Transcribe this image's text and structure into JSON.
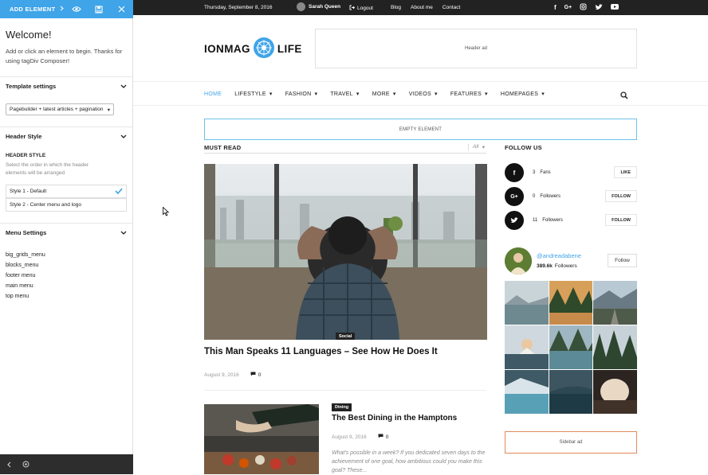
{
  "panel": {
    "add_element": "ADD ELEMENT",
    "welcome_title": "Welcome!",
    "welcome_text": "Add or click an element to begin. Thanks for using tagDiv Composer!",
    "template_settings": "Template settings",
    "template_value": "Pagebuilder + latest articles + pagination",
    "header_style": "Header Style",
    "header_style_label": "HEADER STYLE",
    "header_style_desc": "Select the order in which the header elements will be arranged",
    "style1": "Style 1 - Default",
    "style2": "Style 2 - Center menu and logo",
    "menu_settings": "Menu Settings",
    "menus": [
      "big_grids_menu",
      "blocks_menu",
      "footer menu",
      "main menu",
      "top menu"
    ]
  },
  "topbar": {
    "date": "Thursday, September 8, 2016",
    "user": "Sarah Queen",
    "logout": "Logout",
    "links": [
      "Blog",
      "About me",
      "Contact"
    ],
    "social_icons": [
      "facebook-icon",
      "google-plus-icon",
      "instagram-icon",
      "twitter-icon",
      "youtube-icon"
    ]
  },
  "header": {
    "logo_left": "IONMAG",
    "logo_right": "LIFE",
    "ad_label": "Header ad"
  },
  "nav": {
    "items": [
      "HOME",
      "LIFESTYLE",
      "FASHION",
      "TRAVEL",
      "MORE",
      "VIDEOS",
      "FEATURES",
      "HOMEPAGES"
    ]
  },
  "empty_element": "EMPTY ELEMENT",
  "main": {
    "block_title": "MUST READ",
    "filter": "All",
    "hero": {
      "category": "Social",
      "title": "This Man Speaks 11 Languages – See How He Does It",
      "date": "August 9, 2016",
      "comments": "0"
    },
    "article2": {
      "category": "Dining",
      "title": "The Best Dining in the Hamptons",
      "date": "August 9, 2016",
      "comments": "0",
      "excerpt": "What's possible in a week? If you dedicated seven days to the achievement of one goal, how ambitious could you make this goal? These..."
    }
  },
  "sidebar": {
    "follow_title": "FOLLOW US",
    "social": [
      {
        "icon": "facebook-icon",
        "count": "3",
        "label": "Fans",
        "button": "LIKE"
      },
      {
        "icon": "google-plus-icon",
        "count": "0",
        "label": "Followers",
        "button": "FOLLOW"
      },
      {
        "icon": "twitter-icon",
        "count": "11",
        "label": "Followers",
        "button": "FOLLOW"
      }
    ],
    "instagram": {
      "handle": "@andreadabene",
      "followers_count": "389.6k",
      "followers_label": "Followers",
      "follow_button": "Follow"
    },
    "ad_label": "Sidebar ad"
  },
  "colors": {
    "accent": "#3fa4e8",
    "topbar": "#222222",
    "sidebar_ad_border": "#e08a5a"
  }
}
